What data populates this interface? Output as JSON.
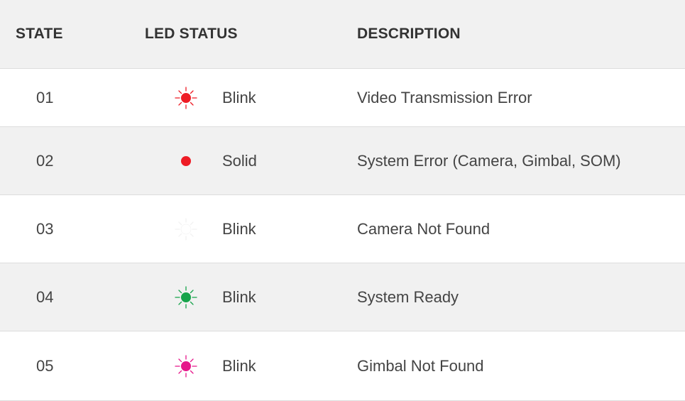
{
  "header": {
    "state": "STATE",
    "led_status": "LED STATUS",
    "description": "DESCRIPTION"
  },
  "rows": [
    {
      "state": "01",
      "led_mode": "Blink",
      "led_color": "#ee1c25",
      "led_icon": "blinking-led-icon",
      "description": "Video Transmission Error"
    },
    {
      "state": "02",
      "led_mode": "Solid",
      "led_color": "#ee1c25",
      "led_icon": "solid-led-icon",
      "description": "System Error (Camera, Gimbal, SOM)"
    },
    {
      "state": "03",
      "led_mode": "Blink",
      "led_color": "#ffffff",
      "led_icon": "blinking-led-icon",
      "description": "Camera Not Found"
    },
    {
      "state": "04",
      "led_mode": "Blink",
      "led_color": "#16a34a",
      "led_icon": "blinking-led-icon",
      "description": "System Ready"
    },
    {
      "state": "05",
      "led_mode": "Blink",
      "led_color": "#e6168a",
      "led_icon": "blinking-led-icon",
      "description": "Gimbal Not Found"
    }
  ]
}
